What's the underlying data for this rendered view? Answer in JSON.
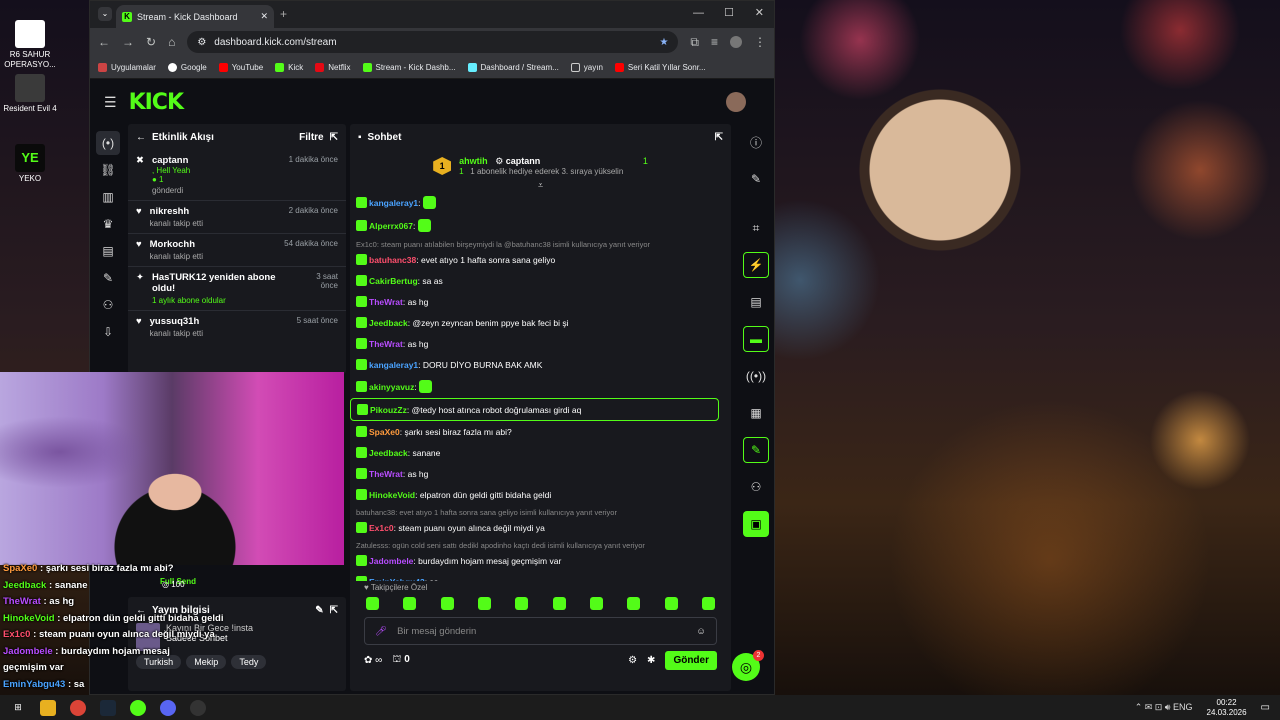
{
  "desktop": {
    "icons": [
      {
        "label": "R6 SAHUR OPERASYO..."
      },
      {
        "label": "Resident Evil 4"
      },
      {
        "label": "YEKO"
      }
    ]
  },
  "browser": {
    "tab_title": "Stream - Kick Dashboard",
    "url": "dashboard.kick.com/stream",
    "bookmarks": [
      "Uygulamalar",
      "Google",
      "YouTube",
      "Kick",
      "Netflix",
      "Stream - Kick Dashb...",
      "Dashboard / Stream...",
      "yayın",
      "Seri Katil Yıllar Sonr..."
    ]
  },
  "activity": {
    "title": "Etkinlik Akışı",
    "filter": "Filtre",
    "items": [
      {
        "name": "captann",
        "time": "1 dakika önce",
        "msg": ", Hell Yeah",
        "count": "1",
        "action": "gönderdi"
      },
      {
        "name": "nikreshh",
        "time": "2 dakika önce",
        "action": "kanalı takip etti"
      },
      {
        "name": "Morkochh",
        "time": "54 dakika önce",
        "action": "kanalı takip etti"
      },
      {
        "name": "HasTURK12 yeniden abone oldu!",
        "time": "3 saat önce",
        "action": "1 aylık abone oldular"
      },
      {
        "name": "yussuq31h",
        "time": "5 saat önce",
        "action": "kanalı takip etti"
      }
    ]
  },
  "chat": {
    "title": "Sohbet",
    "pinned": {
      "rank": "1",
      "gifter": "ahwtih",
      "gifter_count": "1",
      "recipient": "captann",
      "recipient_count": "1",
      "text": "1 abonelik hediye ederek 3. sıraya yükselin"
    },
    "messages": [
      {
        "user": "kangaleray1",
        "color": "#4aa3ff",
        "text": "",
        "reply": ""
      },
      {
        "user": "Alperrx067",
        "color": "#53fc18",
        "text": "",
        "reply": ""
      },
      {
        "user": "batuhanc38",
        "color": "#ff4f6d",
        "text": "evet atıyo 1 hafta sonra sana geliyo",
        "reply": "Ex1c0: steam puanı atılabilen birşeymiydi la @batuhanc38 isimli kullanıcıya yanıt veriyor"
      },
      {
        "user": "CakirBertug",
        "color": "#53fc18",
        "text": "sa as",
        "reply": ""
      },
      {
        "user": "TheWrat",
        "color": "#b84dff",
        "text": "as hg",
        "reply": ""
      },
      {
        "user": "Jeedback",
        "color": "#53fc18",
        "text": "@zeyn zeyncan benim ppye bak feci bi şi",
        "reply": ""
      },
      {
        "user": "TheWrat",
        "color": "#b84dff",
        "text": "as hg",
        "reply": ""
      },
      {
        "user": "kangaleray1",
        "color": "#4aa3ff",
        "text": "DORU DİYO BURNA BAK AMK",
        "reply": ""
      },
      {
        "user": "akinyyavuz",
        "color": "#53fc18",
        "text": "",
        "reply": ""
      },
      {
        "user": "PikouzZz",
        "color": "#53fc18",
        "text": "@tedy host atınca robot doğrulaması girdi aq",
        "reply": ""
      },
      {
        "user": "SpaXe0",
        "color": "#ff9b3d",
        "text": "şarkı sesi biraz fazla mı abi?",
        "reply": ""
      },
      {
        "user": "Jeedback",
        "color": "#53fc18",
        "text": "sanane",
        "reply": ""
      },
      {
        "user": "TheWrat",
        "color": "#b84dff",
        "text": "as hg",
        "reply": ""
      },
      {
        "user": "HinokeVoid",
        "color": "#53fc18",
        "text": "elpatron dün geldi gitti bidaha geldi",
        "reply": ""
      },
      {
        "user": "Ex1c0",
        "color": "#ff4f6d",
        "text": "steam puanı oyun alınca değil miydi ya",
        "reply": "batuhanc38: evet atıyo 1 hafta sonra sana geliyo isimli kullanıcıya yanıt veriyor"
      },
      {
        "user": "Jadombele",
        "color": "#b84dff",
        "text": "burdaydım hojam mesaj geçmişim var",
        "reply": "Zatulesss: ogün cold seni sattı dedikl apodinho kaçtı dedi isimli kullanıcıya yanıt veriyor"
      },
      {
        "user": "EminYabgu43",
        "color": "#4aa3ff",
        "text": "sa",
        "reply": ""
      }
    ],
    "emote_label": "Takipçilere Özel",
    "input_placeholder": "Bir mesaj gönderin",
    "points": "0",
    "send": "Gönder",
    "notif_count": "2"
  },
  "stream_info": {
    "title": "Yayın bilgisi",
    "category": "Sadece Sohbet",
    "stream_title": "Kayını Bir Gece !insta",
    "tags": [
      "Turkish",
      "Mekip",
      "Tedy"
    ],
    "fullsend": "Full Send",
    "fullsend_count": "100"
  },
  "overlay_chat": [
    {
      "user": "SpaXe0",
      "text": "şarkı sesi biraz fazla mı abi?",
      "color": "#ff9b3d"
    },
    {
      "user": "Jeedback",
      "text": "sanane",
      "color": "#53fc18"
    },
    {
      "user": "TheWrat",
      "text": "as hg",
      "color": "#b84dff"
    },
    {
      "user": "HinokeVoid",
      "text": "elpatron dün geldi gitti bidaha geldi",
      "color": "#53fc18"
    },
    {
      "user": "Ex1c0",
      "text": "steam puanı oyun alınca değil miydi ya",
      "color": "#ff4f6d"
    },
    {
      "user": "Jadombele",
      "text": "burdaydım hojam mesaj",
      "color": "#b84dff"
    },
    {
      "user": "",
      "text": "geçmişim var",
      "color": "#ffffff"
    },
    {
      "user": "EminYabgu43",
      "text": "sa",
      "color": "#4aa3ff"
    }
  ],
  "taskbar": {
    "time": "00:22",
    "date": "24.03.2026"
  }
}
